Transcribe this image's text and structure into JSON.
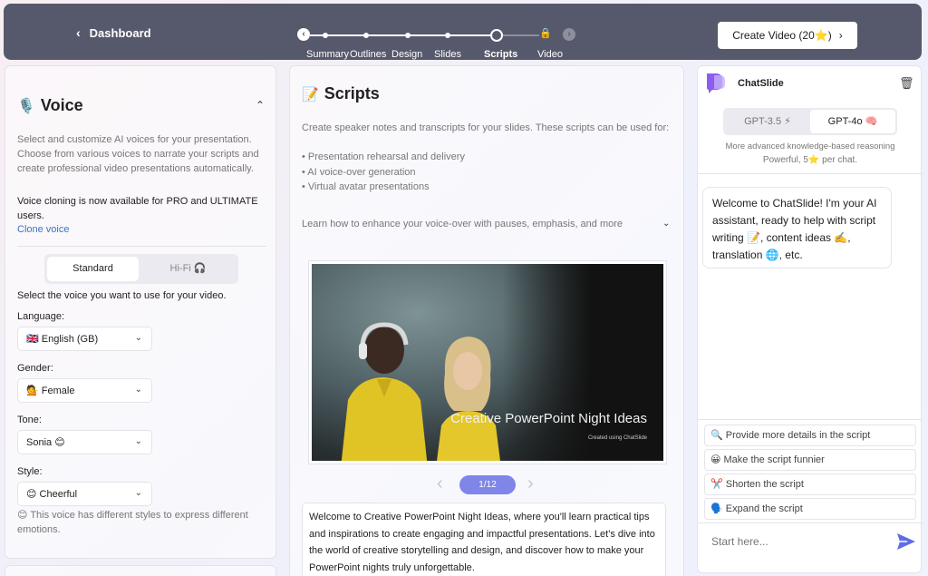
{
  "topbar": {
    "back_label": "Dashboard",
    "steps": [
      "Summary",
      "Outlines",
      "Design",
      "Slides",
      "Scripts",
      "Video"
    ],
    "active_step": "Scripts",
    "create_button": "Create Video (20⭐️)"
  },
  "voice_panel": {
    "icon": "🎙️",
    "title": "Voice",
    "description": "Select and customize AI voices for your presentation. Choose from various voices to narrate your scripts and create professional video presentations automatically.",
    "cloning_note": "Voice cloning is now available for PRO and ULTIMATE users.",
    "clone_link": "Clone voice",
    "tabs": [
      "Standard",
      "Hi-Fi 🎧"
    ],
    "selected_tab": "Standard",
    "select_prompt": "Select the voice you want to use for your video.",
    "language_label": "Language:",
    "language_value": "🇬🇧 English (GB)",
    "gender_label": "Gender:",
    "gender_value": "💁 Female",
    "tone_label": "Tone:",
    "tone_value": "Sonia 😊",
    "style_label": "Style:",
    "style_value": "😊 Cheerful",
    "style_note": "😊 This voice has different styles to express different emotions."
  },
  "scripts_panel": {
    "icon": "📝",
    "title": "Scripts",
    "description": "Create speaker notes and transcripts for your slides. These scripts can be used for:",
    "uses": [
      "• Presentation rehearsal and delivery",
      "• AI voice-over generation",
      "• Virtual avatar presentations"
    ],
    "learn_more": "Learn how to enhance your voice-over with pauses, emphasis, and more",
    "slide_title": "Creative PowerPoint Night Ideas",
    "slide_subtitle": "Created using ChatSlide",
    "page_indicator": "1/12",
    "transcript": "Welcome to Creative PowerPoint Night Ideas, where you'll learn practical tips and inspirations to create engaging and impactful presentations. Let's dive into the world of creative storytelling and design, and discover how to make your PowerPoint nights truly unforgettable."
  },
  "chat_panel": {
    "name": "ChatSlide",
    "models": [
      "GPT-3.5 ⚡",
      "GPT-4o 🧠"
    ],
    "selected_model": "GPT-4o 🧠",
    "model_description": "More advanced knowledge-based reasoning",
    "model_price": "Powerful, 5⭐ per chat.",
    "welcome_message": "Welcome to ChatSlide! I'm your AI assistant, ready to help with script writing 📝, content ideas ✍️, translation 🌐, etc.",
    "suggestions": [
      "🔍 Provide more details in the script",
      "😀 Make the script funnier",
      "✂️ Shorten the script",
      "🗣️ Expand the script"
    ],
    "input_placeholder": "Start here..."
  },
  "colors": {
    "topbar_bg": "#56596c",
    "accent": "#7f86e8",
    "send": "#5d6ee6",
    "link": "#3a73c4"
  }
}
